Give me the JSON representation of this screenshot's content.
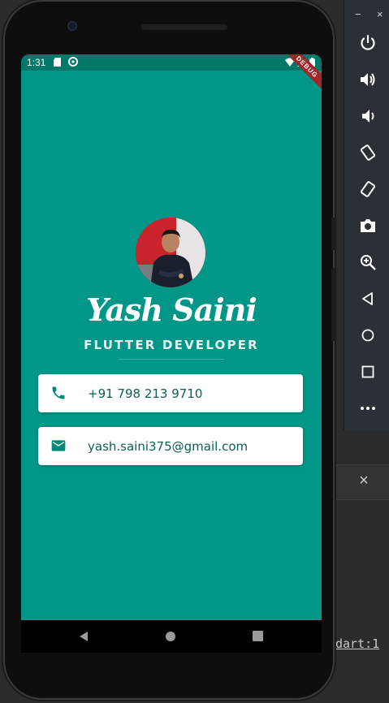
{
  "status_bar": {
    "time": "1:31",
    "debug_label": "DEBUG"
  },
  "profile": {
    "name": "Yash Saini",
    "title": "FLUTTER DEVELOPER",
    "avatar_alt": "profile photo"
  },
  "contacts": [
    {
      "icon": "phone-icon",
      "text": "+91 798 213 9710"
    },
    {
      "icon": "email-icon",
      "text": "yash.saini375@gmail.com"
    }
  ],
  "toolbar": {
    "window_controls": [
      "−",
      "×"
    ],
    "buttons": [
      "power-icon",
      "volume-up-icon",
      "volume-down-icon",
      "rotate-left-icon",
      "rotate-right-icon",
      "camera-icon",
      "zoom-icon",
      "back-icon",
      "home-icon",
      "overview-icon",
      "more-icon"
    ]
  },
  "ide": {
    "close_label": "×",
    "link_text": "dart:1"
  },
  "colors": {
    "primary": "#009688",
    "status_bar": "#00796b",
    "card_text": "#0d5e56",
    "icon": "#00897b"
  }
}
